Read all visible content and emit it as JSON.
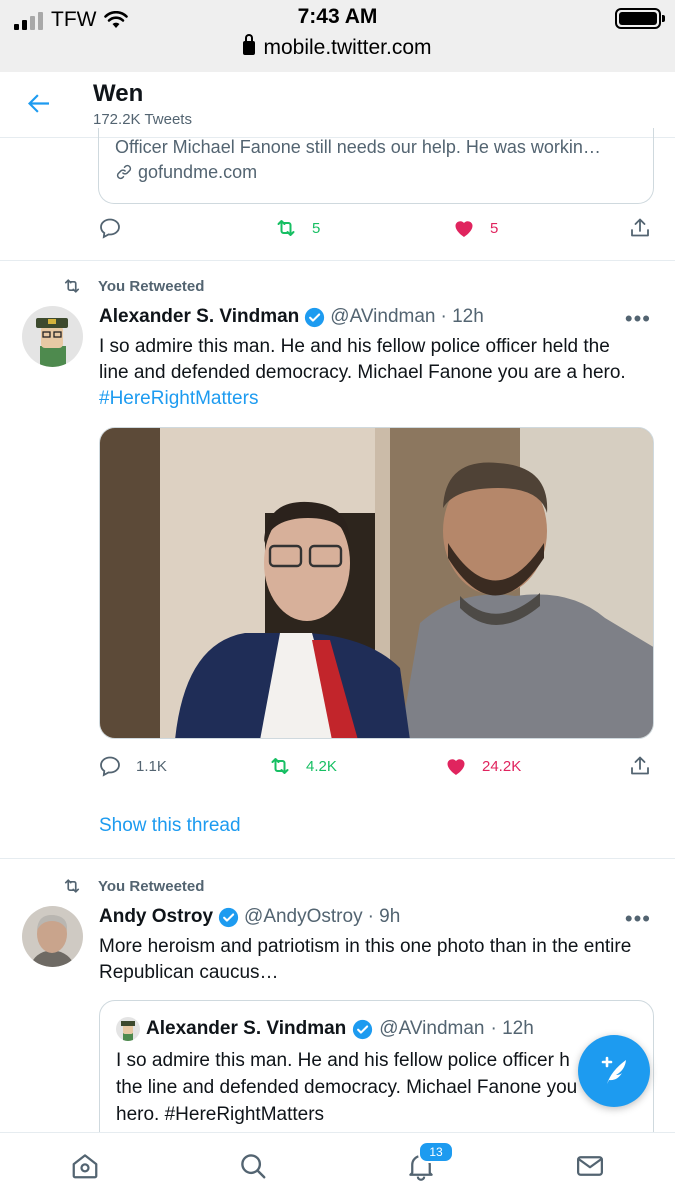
{
  "status_bar": {
    "carrier": "TFW",
    "time": "7:43 AM",
    "url": "mobile.twitter.com"
  },
  "header": {
    "title": "Wen",
    "subtitle": "172.2K Tweets"
  },
  "tweet1": {
    "card_description": "Officer Michael Fanone still needs our help. He was workin…",
    "card_link": "gofundme.com",
    "replies": "",
    "retweets": "5",
    "likes": "5"
  },
  "tweet2": {
    "retweeted_label": "You Retweeted",
    "name": "Alexander S. Vindman",
    "handle": "@AVindman",
    "time": "· 12h",
    "text_line1": "I so admire this man. He and his fellow police officer held the",
    "text_line2": "line and defended democracy. Michael Fanone you are a hero.",
    "hashtag": "#HereRightMatters",
    "replies": "1.1K",
    "retweets": "4.2K",
    "likes": "24.2K",
    "show_thread": "Show this thread"
  },
  "tweet3": {
    "retweeted_label": "You Retweeted",
    "name": "Andy Ostroy",
    "handle": "@AndyOstroy",
    "time": "· 9h",
    "text_line1": "More heroism and patriotism in this one photo than in the entire",
    "text_line2": "Republican caucus…",
    "quote": {
      "name": "Alexander S. Vindman",
      "handle": "@AVindman",
      "time": "· 12h",
      "text_line1": "I so admire this man. He and his fellow police officer h",
      "text_line2": "the line and defended democracy. Michael Fanone you",
      "text_line3": "hero. #HereRightMatters"
    }
  },
  "tabbar": {
    "notifications_count": "13"
  },
  "colors": {
    "accent": "#1d9bf0",
    "retweet": "#17bf63",
    "like": "#e0245e",
    "muted": "#536471"
  },
  "icons": [
    "back-arrow-icon",
    "reply-icon",
    "retweet-icon",
    "heart-icon",
    "share-icon",
    "verified-icon",
    "more-icon",
    "compose-icon",
    "home-icon",
    "search-icon",
    "bell-icon",
    "mail-icon",
    "link-icon",
    "lock-icon"
  ]
}
